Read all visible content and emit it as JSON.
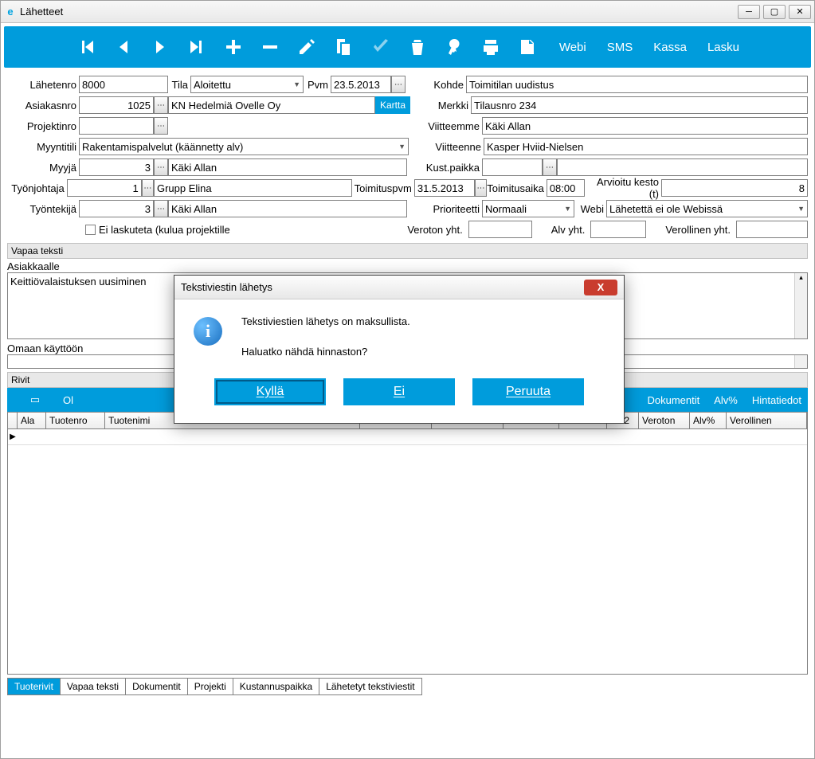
{
  "window": {
    "title": "Lähetteet"
  },
  "toolbar_links": {
    "webi": "Webi",
    "sms": "SMS",
    "kassa": "Kassa",
    "lasku": "Lasku"
  },
  "labels": {
    "lahetenro": "Lähetenro",
    "tila": "Tila",
    "pvm": "Pvm",
    "asiakasnro": "Asiakasnro",
    "kartta": "Kartta",
    "projektinro": "Projektinro",
    "myyntitili": "Myyntitili",
    "myyja": "Myyjä",
    "tyonjohtaja": "Työnjohtaja",
    "tyontekija": "Työntekijä",
    "ei_laskuteta": "Ei laskuteta (kulua projektille",
    "kohde": "Kohde",
    "merkki": "Merkki",
    "viitteemme": "Viitteemme",
    "viitteenne": "Viitteenne",
    "kust_paikka": "Kust.paikka",
    "toimituspvm": "Toimituspvm",
    "toimitusaika": "Toimitusaika",
    "arvioitu_kesto": "Arvioitu kesto (t)",
    "prioriteetti": "Prioriteetti",
    "webi": "Webi",
    "veroton_yht": "Veroton yht.",
    "alv_yht": "Alv yht.",
    "verollinen_yht": "Verollinen yht.",
    "vapaa_teksti": "Vapaa teksti",
    "asiakkaalle": "Asiakkaalle",
    "omaan_kayttoon": "Omaan käyttöön",
    "rivit": "Rivit"
  },
  "fields": {
    "lahetenro": "8000",
    "tila": "Aloitettu",
    "pvm": "23.5.2013",
    "asiakasnro": "1025",
    "asiakas_nimi": "KN Hedelmiä Ovelle Oy",
    "projektinro": "",
    "myyntitili": "Rakentamispalvelut (käännetty alv)",
    "myyja_nro": "3",
    "myyja_nimi": "Käki Allan",
    "tyonjohtaja_nro": "1",
    "tyonjohtaja_nimi": "Grupp Elina",
    "tyontekija_nro": "3",
    "tyontekija_nimi": "Käki Allan",
    "kohde": "Toimitilan uudistus",
    "merkki": "Tilausnro 234",
    "viitteemme": "Käki Allan",
    "viitteenne": "Kasper Hviid-Nielsen",
    "kust_paikka": "",
    "toimituspvm": "31.5.2013",
    "toimitusaika": "08:00",
    "arvioitu_kesto": "8",
    "prioriteetti": "Normaali",
    "webi_status": "Lähetettä ei ole Webissä",
    "veroton_yht": "",
    "alv_yht": "",
    "verollinen_yht": "",
    "asiakkaalle_text": "Keittiövalaistuksen uusiminen",
    "omaan_text": ""
  },
  "rivit_bar": {
    "ol": "Ol",
    "dokumentit": "Dokumentit",
    "alv": "Alv%",
    "hintatiedot": "Hintatiedot"
  },
  "grid_cols": [
    "",
    "Ala",
    "Tuotenro",
    "Tuotenimi",
    "",
    "",
    "",
    "",
    "Ale2",
    "Veroton",
    "Alv%",
    "Verollinen"
  ],
  "tabs": [
    "Tuoterivit",
    "Vapaa teksti",
    "Dokumentit",
    "Projekti",
    "Kustannuspaikka",
    "Lähetetyt tekstiviestit"
  ],
  "modal": {
    "title": "Tekstiviestin lähetys",
    "line1": "Tekstiviestien lähetys on maksullista.",
    "line2": "Haluatko nähdä hinnaston?",
    "yes": "Kyllä",
    "no": "Ei",
    "cancel": "Peruuta"
  }
}
